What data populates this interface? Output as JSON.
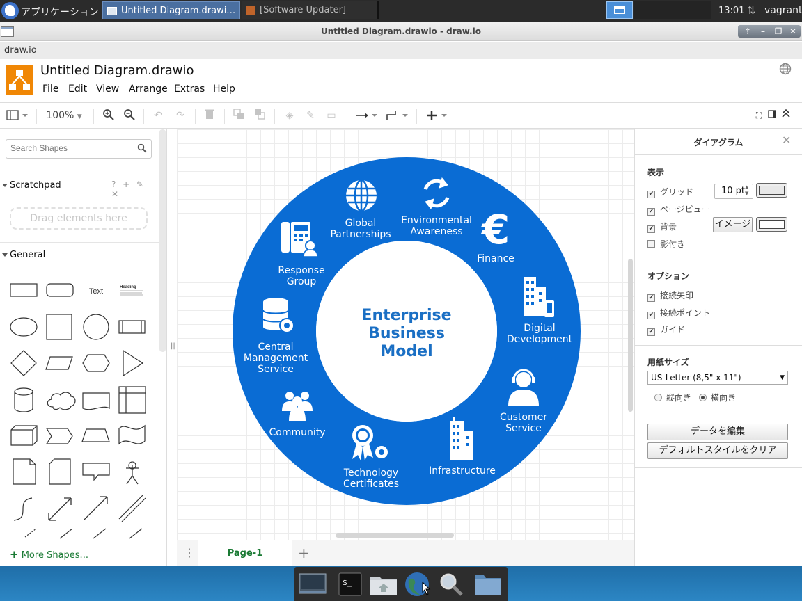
{
  "taskbar": {
    "apps_label": "アプリケーション",
    "tasks": [
      {
        "label": "Untitled Diagram.drawi…"
      },
      {
        "label": "[Software Updater]"
      }
    ],
    "clock": "13:01",
    "user": "vagrant"
  },
  "window": {
    "title": "Untitled Diagram.drawio - draw.io",
    "app_menu": "draw.io"
  },
  "header": {
    "doc_title": "Untitled Diagram.drawio",
    "menu": [
      "File",
      "Edit",
      "View",
      "Arrange",
      "Extras",
      "Help"
    ]
  },
  "toolbar": {
    "zoom": "100%"
  },
  "sidebar": {
    "search_placeholder": "Search Shapes",
    "scratchpad_label": "Scratchpad",
    "scratchpad_tools": "? + ✎ ✕",
    "drop_hint": "Drag elements here",
    "general_label": "General",
    "shape_text_label": "Text",
    "shape_heading_label": "Heading",
    "more_shapes": "More Shapes..."
  },
  "diagram": {
    "center": [
      "Enterprise",
      "Business",
      "Model"
    ],
    "segments": [
      {
        "lines": [
          "Global",
          "Partnerships"
        ],
        "icon": "globe-icon"
      },
      {
        "lines": [
          "Environmental",
          "Awareness"
        ],
        "icon": "recycle-icon"
      },
      {
        "lines": [
          "Finance"
        ],
        "icon": "euro-icon"
      },
      {
        "lines": [
          "Digital",
          "Development"
        ],
        "icon": "buildings-icon"
      },
      {
        "lines": [
          "Customer",
          "Service"
        ],
        "icon": "headset-icon"
      },
      {
        "lines": [
          "Infrastructure"
        ],
        "icon": "skyscraper-icon"
      },
      {
        "lines": [
          "Technology",
          "Certificates"
        ],
        "icon": "award-icon"
      },
      {
        "lines": [
          "Community"
        ],
        "icon": "people-icon"
      },
      {
        "lines": [
          "Central",
          "Management",
          "Service"
        ],
        "icon": "database-icon"
      },
      {
        "lines": [
          "Response",
          "Group"
        ],
        "icon": "phone-icon"
      }
    ],
    "ring_color": "#0a6cd4"
  },
  "pages": {
    "tab": "Page-1"
  },
  "format_panel": {
    "title": "ダイアグラム",
    "view_section": "表示",
    "grid_label": "グリッド",
    "grid_size": "10 pt",
    "page_view_label": "ページビュー",
    "background_label": "背景",
    "image_button": "イメージ",
    "shadow_label": "影付き",
    "options_section": "オプション",
    "connection_arrows": "接続矢印",
    "connection_points": "接続ポイント",
    "guides": "ガイド",
    "paper_size_section": "用紙サイズ",
    "paper_size": "US-Letter (8,5\" x 11\")",
    "portrait": "縦向き",
    "landscape": "横向き",
    "edit_data": "データを編集",
    "clear_style": "デフォルトスタイルをクリア",
    "grid_checked": true,
    "page_view_checked": true,
    "background_checked": true,
    "shadow_checked": false,
    "arrows_checked": true,
    "points_checked": true,
    "guides_checked": true,
    "orientation": "landscape"
  }
}
